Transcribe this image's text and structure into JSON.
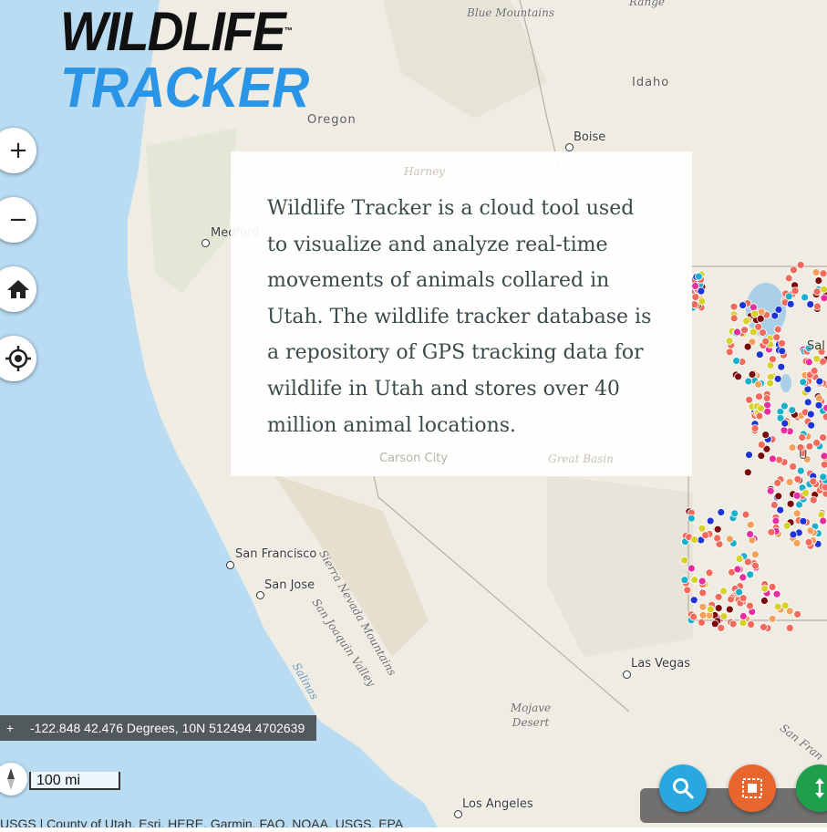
{
  "app": {
    "logo_line1": "WILDLIFE",
    "logo_line2": "TRACKER",
    "logo_tm": "™"
  },
  "map": {
    "labels": {
      "blue_mountains": "Blue Mountains",
      "range": "Range",
      "idaho": "Idaho",
      "oregon": "Oregon",
      "boise": "Boise",
      "harney": "Harney",
      "medford": "Medford",
      "carson_city": "Carson City",
      "great_basin": "Great Basin",
      "sierra_nevada": "Sierra Nevada Mountains",
      "san_francisco": "San Francisco",
      "san_jose": "San Jose",
      "san_joaquin": "San Joaquin Valley",
      "salinas": "Salinas",
      "las_vegas": "Las Vegas",
      "mojave": "Mojave Desert",
      "los_angeles": "Los Angeles",
      "san_fran_partial": "San Fran",
      "salt_partial": "Sal",
      "utah_partial": "U"
    },
    "colors": {
      "ocean": "#b9dcf2",
      "land": "#eeebe2",
      "tracking_red": "#f26a5b",
      "tracking_blue": "#1f34d6",
      "tracking_yellow": "#d7d22a",
      "tracking_darkred": "#7a0a0a",
      "tracking_orange": "#f3a05a",
      "tracking_teal": "#1bb0c9",
      "tracking_magenta": "#e52fa0"
    }
  },
  "controls": {
    "zoom_in": "+",
    "zoom_out": "−",
    "home_icon": "home-icon",
    "locate_icon": "locate-icon"
  },
  "info_card": {
    "text": "Wildlife Tracker is a cloud tool used to visualize and analyze real-time movements of animals collared in Utah. The wildlife tracker database is a repository of GPS tracking data for wildlife in Utah and stores over 40 million animal locations."
  },
  "coordinates": {
    "toggle": "+",
    "readout": "-122.848 42.476 Degrees, 10N 512494 4702639"
  },
  "scale": {
    "label": "100 mi"
  },
  "attribution": {
    "text": "USGS | County of Utah, Esri, HERE, Garmin, FAO, NOAA, USGS, EPA"
  },
  "actions": {
    "search_color": "#29a8e0",
    "select_color": "#e8652d",
    "expand_color": "#1ea04a"
  }
}
